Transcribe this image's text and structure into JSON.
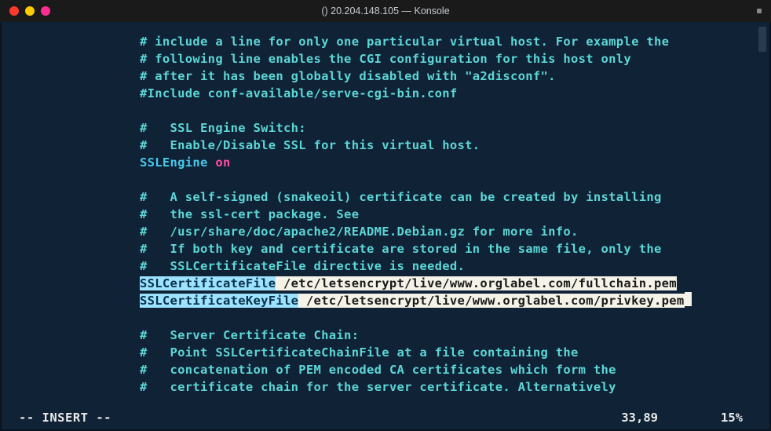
{
  "window": {
    "title": "() 20.204.148.105 — Konsole"
  },
  "editor": {
    "lines": {
      "c1": "# include a line for only one particular virtual host. For example the",
      "c2": "# following line enables the CGI configuration for this host only",
      "c3": "# after it has been globally disabled with \"a2disconf\".",
      "c4": "#Include conf-available/serve-cgi-bin.conf",
      "c5": "#   SSL Engine Switch:",
      "c6": "#   Enable/Disable SSL for this virtual host.",
      "d1": "SSLEngine",
      "v1": "on",
      "c7": "#   A self-signed (snakeoil) certificate can be created by installing",
      "c8": "#   the ssl-cert package. See",
      "c9": "#   /usr/share/doc/apache2/README.Debian.gz for more info.",
      "c10": "#   If both key and certificate are stored in the same file, only the",
      "c11": "#   SSLCertificateFile directive is needed.",
      "d2": "SSLCertificateFile",
      "p2": " /etc/letsencrypt/live/www.orglabel.com/fullchain.pem",
      "d3": "SSLCertificateKeyFile",
      "p3": " /etc/letsencrypt/live/www.orglabel.com/privkey.pem",
      "c12": "#   Server Certificate Chain:",
      "c13": "#   Point SSLCertificateChainFile at a file containing the",
      "c14": "#   concatenation of PEM encoded CA certificates which form the",
      "c15": "#   certificate chain for the server certificate. Alternatively"
    }
  },
  "status": {
    "mode": "-- INSERT --",
    "position": "33,89",
    "percent": "15%"
  }
}
